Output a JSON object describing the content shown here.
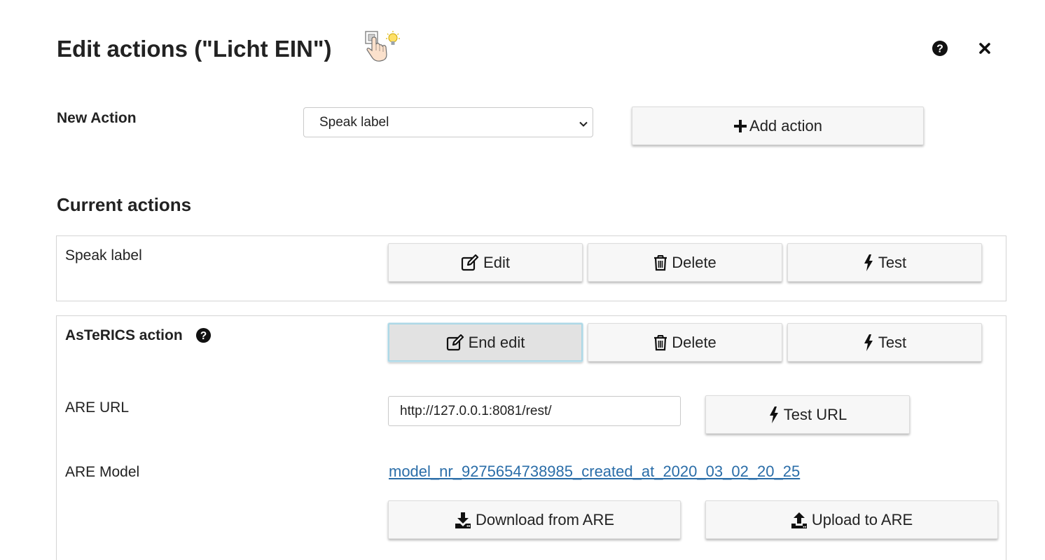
{
  "dialog": {
    "title": "Edit actions (\"Licht EIN\")",
    "title_icon": "pointing-hand-lightbulb-icon",
    "help_icon": "question-circle-icon",
    "close_icon": "close-x-icon"
  },
  "new_action": {
    "label": "New Action",
    "selected_value": "Speak label",
    "add_button_label": "Add action"
  },
  "current_actions": {
    "heading": "Current actions",
    "items": [
      {
        "name": "Speak label",
        "edit_label": "Edit",
        "delete_label": "Delete",
        "test_label": "Test"
      },
      {
        "name": "AsTeRICS action",
        "edit_label": "End edit",
        "delete_label": "Delete",
        "test_label": "Test",
        "fields": {
          "are_url_label": "ARE URL",
          "are_url_value": "http://127.0.0.1:8081/rest/",
          "test_url_label": "Test URL",
          "are_model_label": "ARE Model",
          "are_model_link": "model_nr_9275654738985_created_at_2020_03_02_20_25",
          "download_label": "Download from ARE",
          "upload_label": "Upload to ARE"
        }
      }
    ]
  },
  "colors": {
    "link": "#2a6da8",
    "button_bg": "#f7f7f7",
    "active_button_bg": "#e2e2e2",
    "active_button_border": "#add8e6"
  }
}
